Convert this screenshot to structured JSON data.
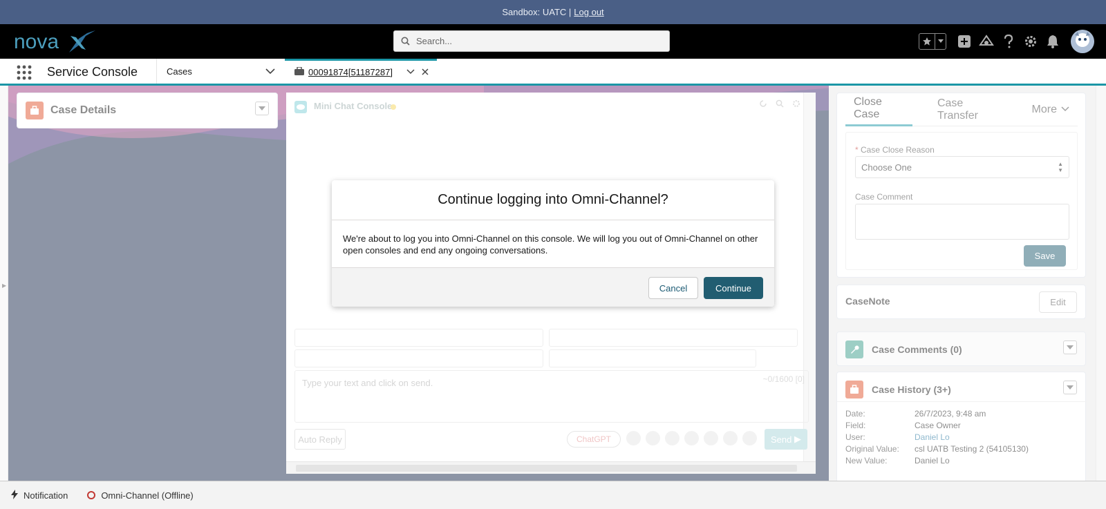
{
  "sandbox": {
    "label": "Sandbox: UATC |",
    "logout": "Log out"
  },
  "header": {
    "logo_text": "novaX",
    "search_placeholder": "Search...",
    "icons": [
      "favorites-star-icon",
      "favorites-dropdown-icon",
      "global-create-icon",
      "trailhead-icon",
      "help-icon",
      "setup-gear-icon",
      "notifications-bell-icon",
      "user-avatar"
    ]
  },
  "nav": {
    "app_name": "Service Console",
    "object_tab": "Cases",
    "record_tab": "00091874[51187287]"
  },
  "left": {
    "case_details_title": "Case Details"
  },
  "chat": {
    "title": "Mini Chat Console",
    "message_placeholder": "Type your text and click on send.",
    "counter": "~0/1600 [0]",
    "auto_reply": "Auto Reply",
    "chatgpt": "ChatGPT",
    "send": "Send"
  },
  "right": {
    "tabs": [
      "Close Case",
      "Case Transfer",
      "More"
    ],
    "close_reason_label": "Case Close Reason",
    "close_reason_value": "Choose One",
    "comment_label": "Case Comment",
    "save": "Save",
    "casenote_title": "CaseNote",
    "edit": "Edit",
    "comments_title": "Case Comments (0)",
    "history_title": "Case History (3+)",
    "history": [
      {
        "k": "Date:",
        "v": "26/7/2023, 9:48 am",
        "link": false
      },
      {
        "k": "Field:",
        "v": "Case Owner",
        "link": false
      },
      {
        "k": "User:",
        "v": "Daniel Lo",
        "link": true
      },
      {
        "k": "Original Value:",
        "v": "csl UATB Testing 2 (54105130)",
        "link": false
      },
      {
        "k": "New Value:",
        "v": "Daniel Lo",
        "link": false
      }
    ]
  },
  "modal": {
    "title": "Continue logging into Omni-Channel?",
    "body": "We're about to log you into Omni-Channel on this console. We will log you out of Omni-Channel on other open consoles and end any ongoing conversations.",
    "cancel": "Cancel",
    "continue": "Continue"
  },
  "utility": {
    "notification": "Notification",
    "omni": "Omni-Channel (Offline)"
  },
  "colors": {
    "accent": "#1b96a6",
    "brand_button": "#215d71",
    "banner": "#4a5f86"
  }
}
